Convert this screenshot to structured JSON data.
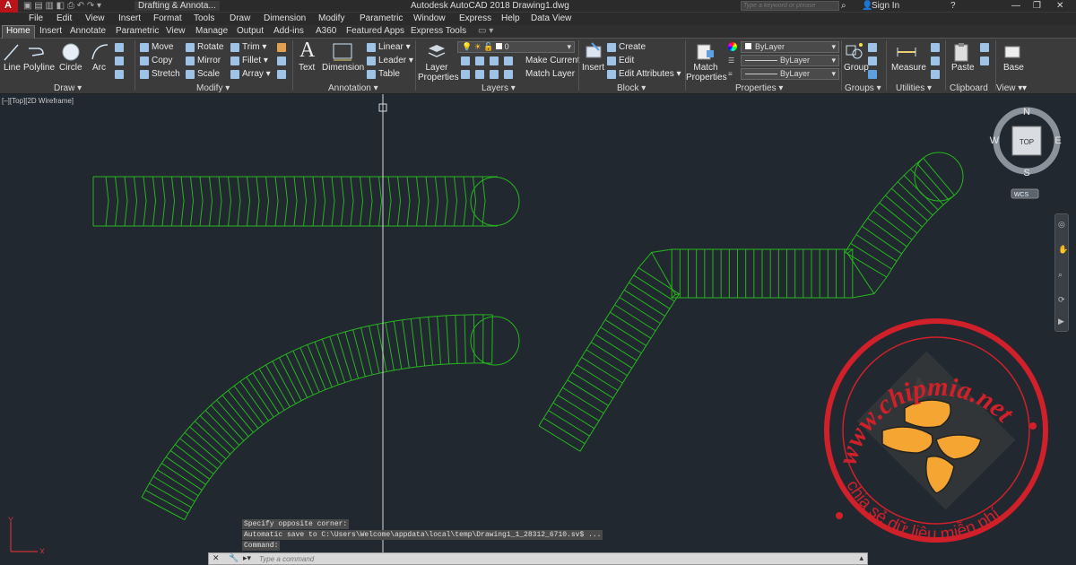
{
  "window": {
    "app_letter": "A",
    "workspace": "Drafting & Annota...",
    "title": "Autodesk AutoCAD 2018    Drawing1.dwg",
    "search_placeholder": "Type a keyword or phrase",
    "sign_in": "Sign In"
  },
  "menu": [
    "File",
    "Edit",
    "View",
    "Insert",
    "Format",
    "Tools",
    "Draw",
    "Dimension",
    "Modify",
    "Parametric",
    "Window",
    "Express",
    "Help",
    "Data View"
  ],
  "tabs": [
    "Home",
    "Insert",
    "Annotate",
    "Parametric",
    "View",
    "Manage",
    "Output",
    "Add-ins",
    "A360",
    "Featured Apps",
    "Express Tools"
  ],
  "ribbon": {
    "draw": {
      "line": "Line",
      "polyline": "Polyline",
      "circle": "Circle",
      "arc": "Arc",
      "panel": "Draw ▾"
    },
    "modify": {
      "move": "Move",
      "rotate": "Rotate",
      "trim": "Trim ▾",
      "copy": "Copy",
      "mirror": "Mirror",
      "fillet": "Fillet ▾",
      "stretch": "Stretch",
      "scale": "Scale",
      "array": "Array ▾",
      "panel": "Modify ▾"
    },
    "annotation": {
      "text": "Text",
      "dimension": "Dimension",
      "linear": "Linear ▾",
      "leader": "Leader ▾",
      "table": "Table",
      "panel": "Annotation ▾"
    },
    "layers": {
      "layer_properties": "Layer Properties",
      "current_layer": "0",
      "make_current": "Make Current",
      "match_layer": "Match Layer",
      "panel": "Layers ▾"
    },
    "block": {
      "insert": "Insert",
      "create": "Create",
      "edit": "Edit",
      "edit_attributes": "Edit Attributes ▾",
      "panel": "Block ▾"
    },
    "properties": {
      "match_properties": "Match Properties",
      "color": "ByLayer",
      "linetype": "ByLayer",
      "lineweight": "ByLayer",
      "panel": "Properties ▾"
    },
    "groups": {
      "group": "Group",
      "panel": "Groups ▾"
    },
    "utilities": {
      "measure": "Measure",
      "panel": "Utilities ▾"
    },
    "clipboard": {
      "paste": "Paste",
      "panel": "Clipboard"
    },
    "view": {
      "base": "Base",
      "panel": "View ▾"
    }
  },
  "viewport_label": "[–][Top][2D Wireframe]",
  "viewcube": {
    "n": "N",
    "s": "S",
    "e": "E",
    "w": "W",
    "face": "TOP",
    "ucs": "WCS"
  },
  "ucs_icon": {
    "x": "X",
    "y": "Y"
  },
  "command": {
    "history": [
      "Specify opposite corner:",
      "Automatic save to C:\\Users\\Welcome\\appdata\\local\\temp\\Drawing1_1_28312_6710.sv$ ...",
      "Command:"
    ],
    "placeholder": "Type a command"
  },
  "watermark": {
    "url": "www.chipmia.net",
    "tagline": "chia sẻ dữ liệu miễn phí"
  },
  "colors": {
    "drawing": "#27b41f",
    "background": "#212830",
    "watermark": "#d0202a",
    "hand": "#f5a531"
  }
}
